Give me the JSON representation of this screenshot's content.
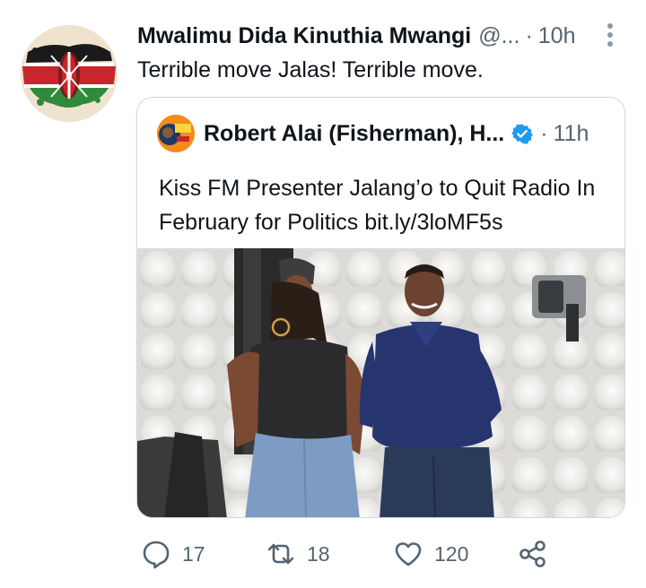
{
  "tweet": {
    "author_name": "Mwalimu Dida Kinuthia Mwangi",
    "handle": "@...",
    "time": "10h",
    "text": "Terrible move Jalas! Terrible move."
  },
  "quoted": {
    "author_name": "Robert Alai (Fisherman), H...",
    "time": "11h",
    "text": "Kiss FM Presenter Jalang’o to Quit Radio In February for Politics bit.ly/3loMF5s"
  },
  "actions": {
    "reply_count": "17",
    "retweet_count": "18",
    "like_count": "120"
  },
  "colors": {
    "text": "#0f1419",
    "secondary": "#536471",
    "verified": "#1d9bf0",
    "border": "#cfd9de"
  }
}
